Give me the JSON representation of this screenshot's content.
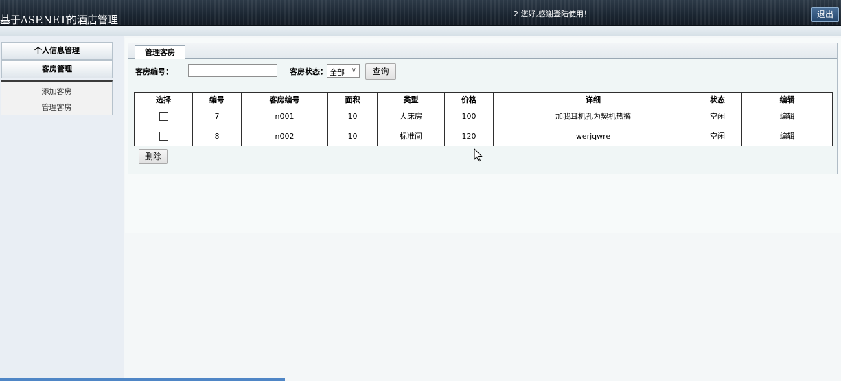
{
  "header": {
    "app_title": "基于ASP.NET的酒店管理",
    "welcome_text": "2 您好,感谢登陆使用！",
    "logout_label": "退出"
  },
  "sidebar": {
    "sections": [
      {
        "label": "个人信息管理"
      },
      {
        "label": "客房管理"
      }
    ],
    "sub_items": [
      {
        "label": "添加客房"
      },
      {
        "label": "管理客房"
      }
    ]
  },
  "panel": {
    "tab_label": "管理客房",
    "search": {
      "room_no_label": "客房编号：",
      "room_no_value": "",
      "status_label": "客房状态：",
      "status_selected": "全部",
      "query_label": "查询"
    },
    "table": {
      "columns": [
        "选择",
        "编号",
        "客房编号",
        "面积",
        "类型",
        "价格",
        "详细",
        "状态",
        "编辑"
      ],
      "rows": [
        {
          "checked": false,
          "id": "7",
          "room_no": "n001",
          "area": "10",
          "type": "大床房",
          "price": "100",
          "detail": "加我耳机孔为契机热裤",
          "status": "空闲",
          "edit": "编辑"
        },
        {
          "checked": false,
          "id": "8",
          "room_no": "n002",
          "area": "10",
          "type": "标准间",
          "price": "120",
          "detail": "werjqwre",
          "status": "空闲",
          "edit": "编辑"
        }
      ]
    },
    "delete_label": "删除"
  },
  "icons": {
    "select_chevron": "chevron-down-icon",
    "pointer": "mouse-pointer-icon"
  },
  "colors": {
    "header_bg": "#1b2632",
    "accent_blue": "#25476d",
    "panel_bg": "#f0f6f6"
  }
}
